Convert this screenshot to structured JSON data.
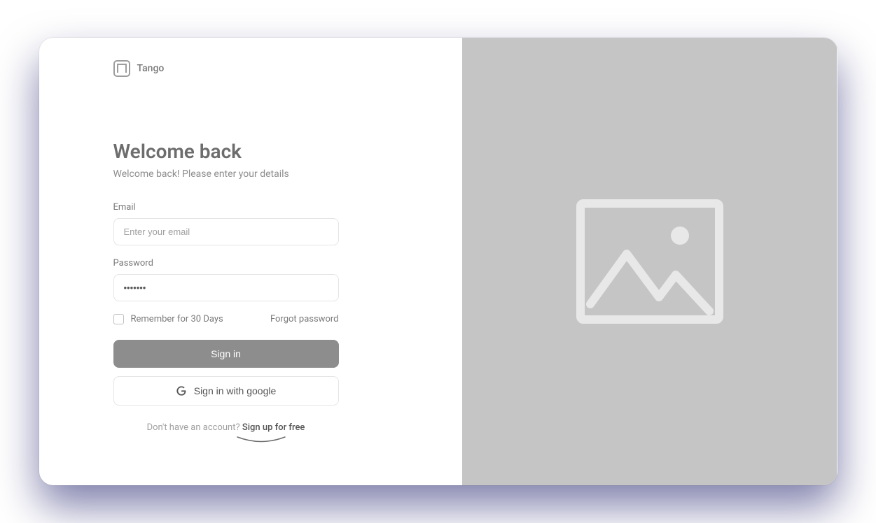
{
  "brand": {
    "name": "Tango"
  },
  "header": {
    "title": "Welcome back",
    "subtitle": "Welcome back! Please enter your details"
  },
  "form": {
    "email_label": "Email",
    "email_placeholder": "Enter your email",
    "password_label": "Password",
    "password_value": "•••••••",
    "remember_label": "Remember for 30 Days",
    "forgot_label": "Forgot password",
    "signin_label": "Sign in",
    "google_label": "Sign in with google"
  },
  "footer": {
    "prompt": "Don't have an account? ",
    "signup_label": "Sign up for free"
  }
}
